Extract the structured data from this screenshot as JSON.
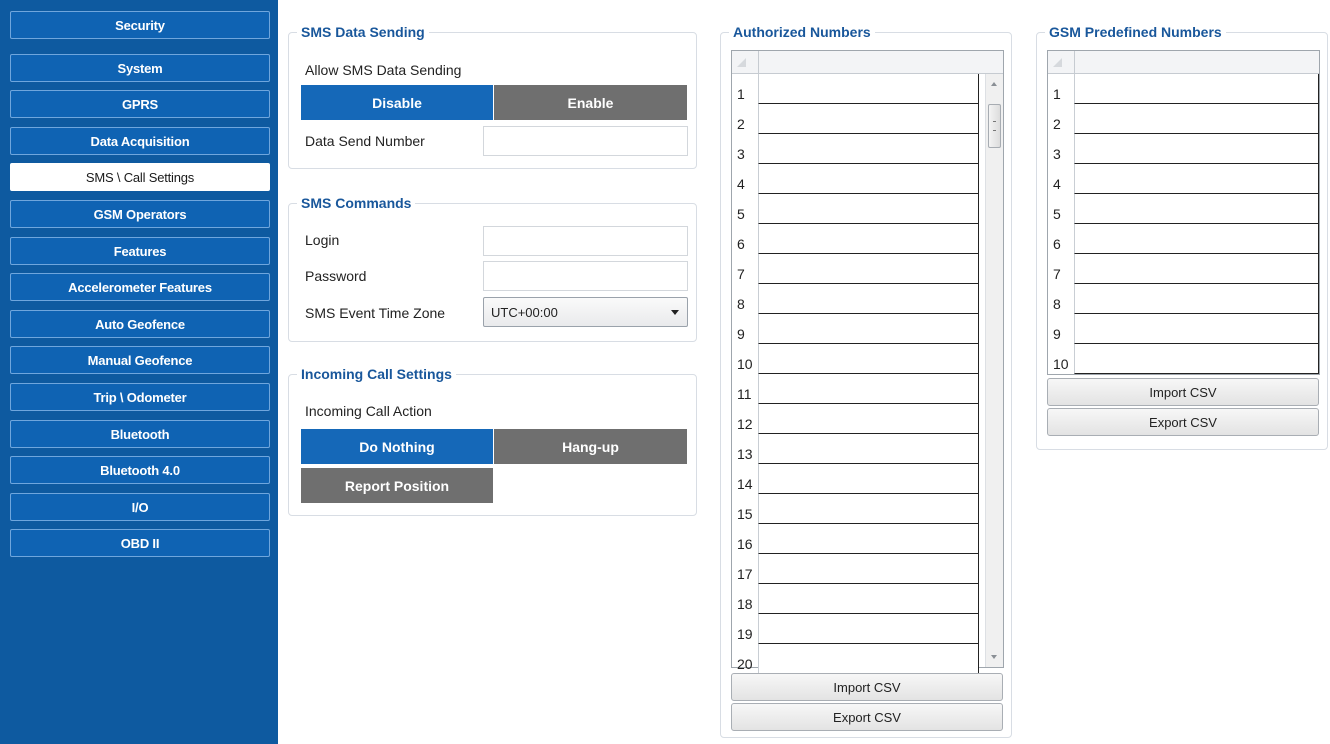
{
  "sidebar": {
    "items": [
      {
        "label": "Security"
      },
      {
        "label": "System"
      },
      {
        "label": "GPRS"
      },
      {
        "label": "Data Acquisition"
      },
      {
        "label": "SMS \\ Call Settings",
        "active": true
      },
      {
        "label": "GSM Operators"
      },
      {
        "label": "Features"
      },
      {
        "label": "Accelerometer Features"
      },
      {
        "label": "Auto Geofence"
      },
      {
        "label": "Manual Geofence"
      },
      {
        "label": "Trip \\ Odometer"
      },
      {
        "label": "Bluetooth"
      },
      {
        "label": "Bluetooth 4.0"
      },
      {
        "label": "I/O"
      },
      {
        "label": "OBD II"
      }
    ]
  },
  "sms_data_sending": {
    "title": "SMS Data Sending",
    "allow_label": "Allow SMS Data Sending",
    "disable_label": "Disable",
    "enable_label": "Enable",
    "selected": "Disable",
    "number_label": "Data Send Number",
    "number_value": ""
  },
  "sms_commands": {
    "title": "SMS Commands",
    "login_label": "Login",
    "login_value": "",
    "password_label": "Password",
    "password_value": "",
    "timezone_label": "SMS Event Time Zone",
    "timezone_value": "UTC+00:00"
  },
  "incoming_call": {
    "title": "Incoming Call Settings",
    "action_label": "Incoming Call Action",
    "options": [
      "Do Nothing",
      "Hang-up",
      "Report Position"
    ],
    "selected": "Do Nothing"
  },
  "authorized_numbers": {
    "title": "Authorized Numbers",
    "rows": [
      "1",
      "2",
      "3",
      "4",
      "5",
      "6",
      "7",
      "8",
      "9",
      "10",
      "11",
      "12",
      "13",
      "14",
      "15",
      "16",
      "17",
      "18",
      "19",
      "20"
    ],
    "import_label": "Import CSV",
    "export_label": "Export CSV"
  },
  "gsm_predefined": {
    "title": "GSM Predefined Numbers",
    "rows": [
      "1",
      "2",
      "3",
      "4",
      "5",
      "6",
      "7",
      "8",
      "9",
      "10"
    ],
    "import_label": "Import CSV",
    "export_label": "Export CSV"
  },
  "colors": {
    "sidebar_bg": "#0e5aa0",
    "accent_blue": "#1568b8",
    "segment_gray": "#6f6f6f",
    "group_title": "#19579b"
  }
}
